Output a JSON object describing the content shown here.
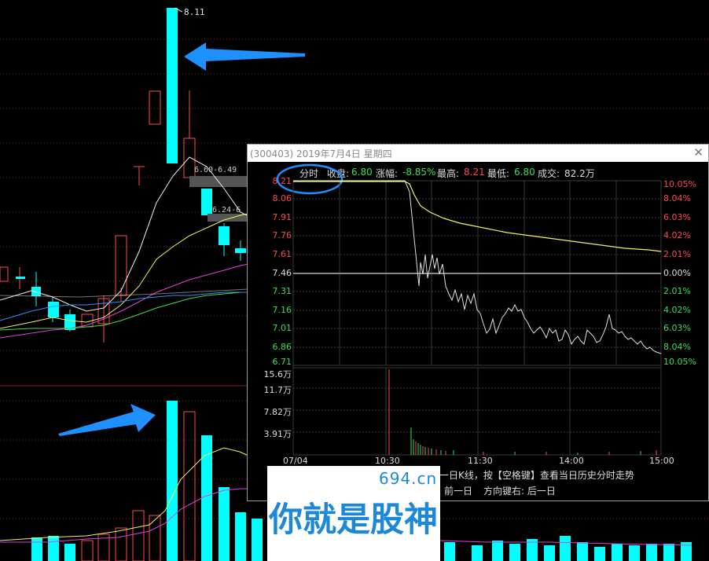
{
  "main_chart": {
    "peak_price_label": "8.11",
    "level_label_1": "6.60-6.49",
    "level_label_2": "6.24-6"
  },
  "popup": {
    "title": "(300403) 2019年7月4日 星期四",
    "close_icon": "close-icon",
    "header": {
      "tab": "分时",
      "close_label": "收盘:",
      "close_value": "6.80",
      "change_label": "涨幅:",
      "change_value": "-8.85%",
      "high_label": "最高:",
      "high_value": "8.21",
      "low_label": "最低:",
      "low_value": "6.80",
      "volume_label": "成交:",
      "volume_value": "82.2万"
    },
    "price_axis_left": [
      "8.21",
      "8.06",
      "7.91",
      "7.76",
      "7.61",
      "7.46",
      "7.31",
      "7.16",
      "7.01",
      "6.86",
      "6.71"
    ],
    "percent_axis_right": [
      "10.05%",
      "8.04%",
      "6.03%",
      "4.02%",
      "2.01%",
      "0.00%",
      "2.01%",
      "4.02%",
      "6.03%",
      "8.04%",
      "10.05%"
    ],
    "volume_axis": [
      "15.6万",
      "11.7万",
      "7.82万",
      "3.91万"
    ],
    "time_axis": [
      "07/04",
      "10:30",
      "11:30",
      "14:00",
      "15:00"
    ],
    "hint_line1": "一日K线，按【空格键】查看当日历史分时走势",
    "hint_line2_a": "前一日",
    "hint_line2_b": "方向键右: 后一日"
  },
  "watermark": {
    "site": "694.cn",
    "slogan": "你就是股神"
  },
  "colors": {
    "bull": "#ff4a4a",
    "bear": "#00ffff",
    "arrow": "#1e90ff",
    "avg_line": "#f2f260",
    "price_line": "#e0e0e0"
  }
}
